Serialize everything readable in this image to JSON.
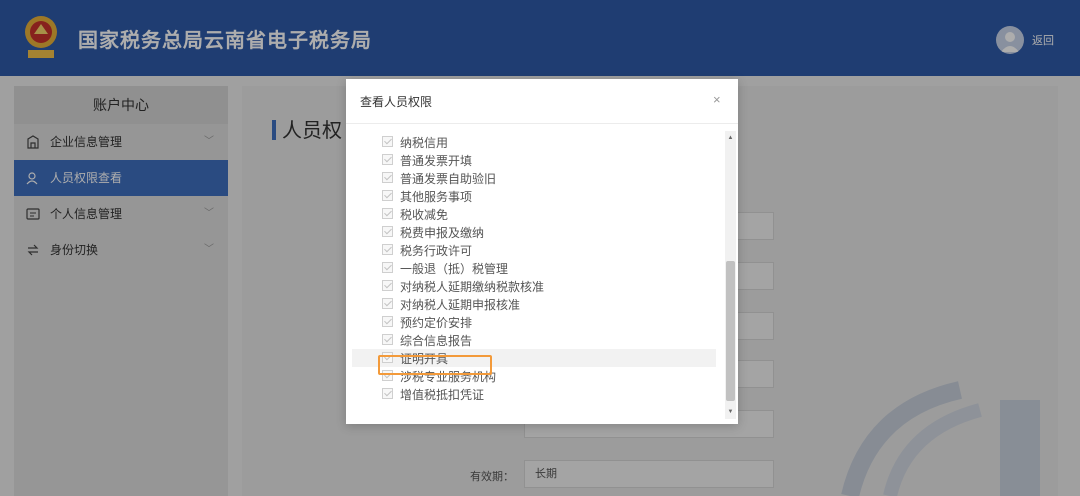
{
  "header": {
    "title": "国家税务总局云南省电子税务局",
    "back_label": "返回",
    "brand_color": "#2f5aa8",
    "logo_icon": "tax-emblem-icon",
    "avatar_icon": "user-avatar-icon"
  },
  "sidebar": {
    "heading": "账户中心",
    "items": [
      {
        "label": "企业信息管理",
        "icon": "building-icon",
        "has_submenu": true,
        "active": false
      },
      {
        "label": "人员权限查看",
        "icon": "user-lock-icon",
        "has_submenu": false,
        "active": true
      },
      {
        "label": "个人信息管理",
        "icon": "id-card-icon",
        "has_submenu": true,
        "active": false
      },
      {
        "label": "身份切换",
        "icon": "switch-icon",
        "has_submenu": true,
        "active": false
      }
    ]
  },
  "main": {
    "page_title": "人员权",
    "fields": [
      {
        "label": "有效期：",
        "value": "长期"
      }
    ]
  },
  "modal": {
    "title": "查看人员权限",
    "close_symbol": "×",
    "highlight_color": "#f39a3a",
    "permissions": [
      {
        "label": "纳税信用",
        "checked": true
      },
      {
        "label": "普通发票开填",
        "checked": true
      },
      {
        "label": "普通发票自助验旧",
        "checked": true
      },
      {
        "label": "其他服务事项",
        "checked": true
      },
      {
        "label": "税收减免",
        "checked": true
      },
      {
        "label": "税费申报及缴纳",
        "checked": true
      },
      {
        "label": "税务行政许可",
        "checked": true
      },
      {
        "label": "一般退（抵）税管理",
        "checked": true
      },
      {
        "label": "对纳税人延期缴纳税款核准",
        "checked": true
      },
      {
        "label": "对纳税人延期申报核准",
        "checked": true
      },
      {
        "label": "预约定价安排",
        "checked": true
      },
      {
        "label": "综合信息报告",
        "checked": true
      },
      {
        "label": "证明开具",
        "checked": true,
        "highlighted": true
      },
      {
        "label": "涉税专业服务机构",
        "checked": true
      },
      {
        "label": "增值税抵扣凭证",
        "checked": true
      }
    ]
  }
}
